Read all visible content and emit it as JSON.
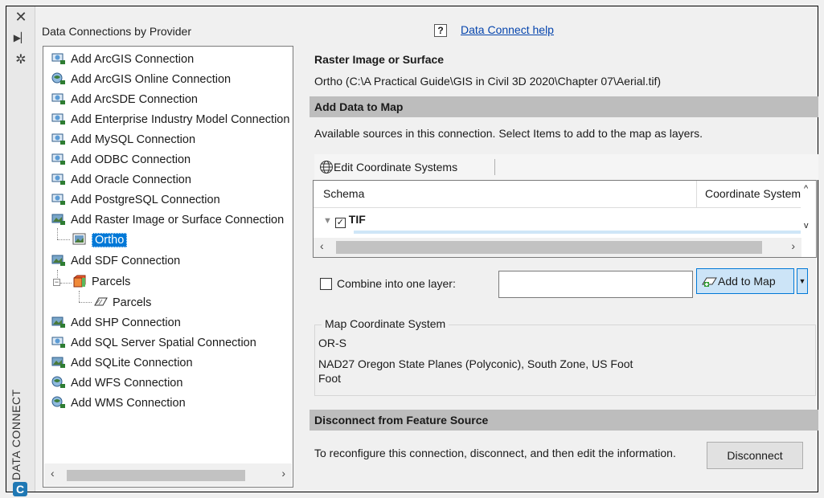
{
  "strip": {
    "title": "DATA CONNECT"
  },
  "left_panel": {
    "title": "Data Connections by Provider",
    "items": [
      {
        "label": "Add ArcGIS Connection",
        "icon": "arcgis-connection-icon"
      },
      {
        "label": "Add ArcGIS Online Connection",
        "icon": "arcgis-online-icon"
      },
      {
        "label": "Add ArcSDE Connection",
        "icon": "arcsde-connection-icon"
      },
      {
        "label": "Add Enterprise Industry Model Connection",
        "icon": "enterprise-model-icon"
      },
      {
        "label": "Add MySQL Connection",
        "icon": "mysql-connection-icon"
      },
      {
        "label": "Add ODBC Connection",
        "icon": "odbc-connection-icon"
      },
      {
        "label": "Add Oracle Connection",
        "icon": "oracle-connection-icon"
      },
      {
        "label": "Add PostgreSQL Connection",
        "icon": "postgresql-connection-icon"
      },
      {
        "label": "Add Raster Image or Surface Connection",
        "icon": "raster-connection-icon"
      },
      {
        "label": "Ortho",
        "icon": "raster-image-icon"
      },
      {
        "label": "Add SDF Connection",
        "icon": "sdf-connection-icon"
      },
      {
        "label": "Parcels",
        "icon": "sdf-file-icon"
      },
      {
        "label": "Parcels",
        "icon": "polygon-layer-icon"
      },
      {
        "label": "Add SHP Connection",
        "icon": "shp-connection-icon"
      },
      {
        "label": "Add SQL Server Spatial Connection",
        "icon": "sqlserver-connection-icon"
      },
      {
        "label": "Add SQLite Connection",
        "icon": "sqlite-connection-icon"
      },
      {
        "label": "Add WFS Connection",
        "icon": "wfs-connection-icon"
      },
      {
        "label": "Add WMS Connection",
        "icon": "wms-connection-icon"
      }
    ]
  },
  "help": {
    "label": "Data Connect help"
  },
  "raster": {
    "title": "Raster Image or Surface",
    "path": "Ortho (C:\\A Practical Guide\\GIS in Civil 3D 2020\\Chapter 07\\Aerial.tif)"
  },
  "add_data": {
    "header": "Add Data to Map",
    "description": "Available sources in this connection.  Select Items to add to the map as layers.",
    "edit_cs_label": "Edit Coordinate Systems",
    "columns": {
      "schema": "Schema",
      "coord": "Coordinate System"
    },
    "row_label": "TIF",
    "combine_label": "Combine into one layer:",
    "combine_value": "",
    "add_button": "Add to Map"
  },
  "map_cs": {
    "legend": "Map Coordinate System",
    "code": "OR-S",
    "description": "NAD27 Oregon State Planes (Polyconic), South Zone, US Foot",
    "unit": "Foot"
  },
  "disconnect": {
    "header": "Disconnect from Feature Source",
    "text": "To reconfigure this connection, disconnect, and then edit the information.",
    "button": "Disconnect"
  },
  "colors": {
    "selection": "#0078d7",
    "section_bar": "#bdbdbd",
    "link": "#0645ad"
  }
}
